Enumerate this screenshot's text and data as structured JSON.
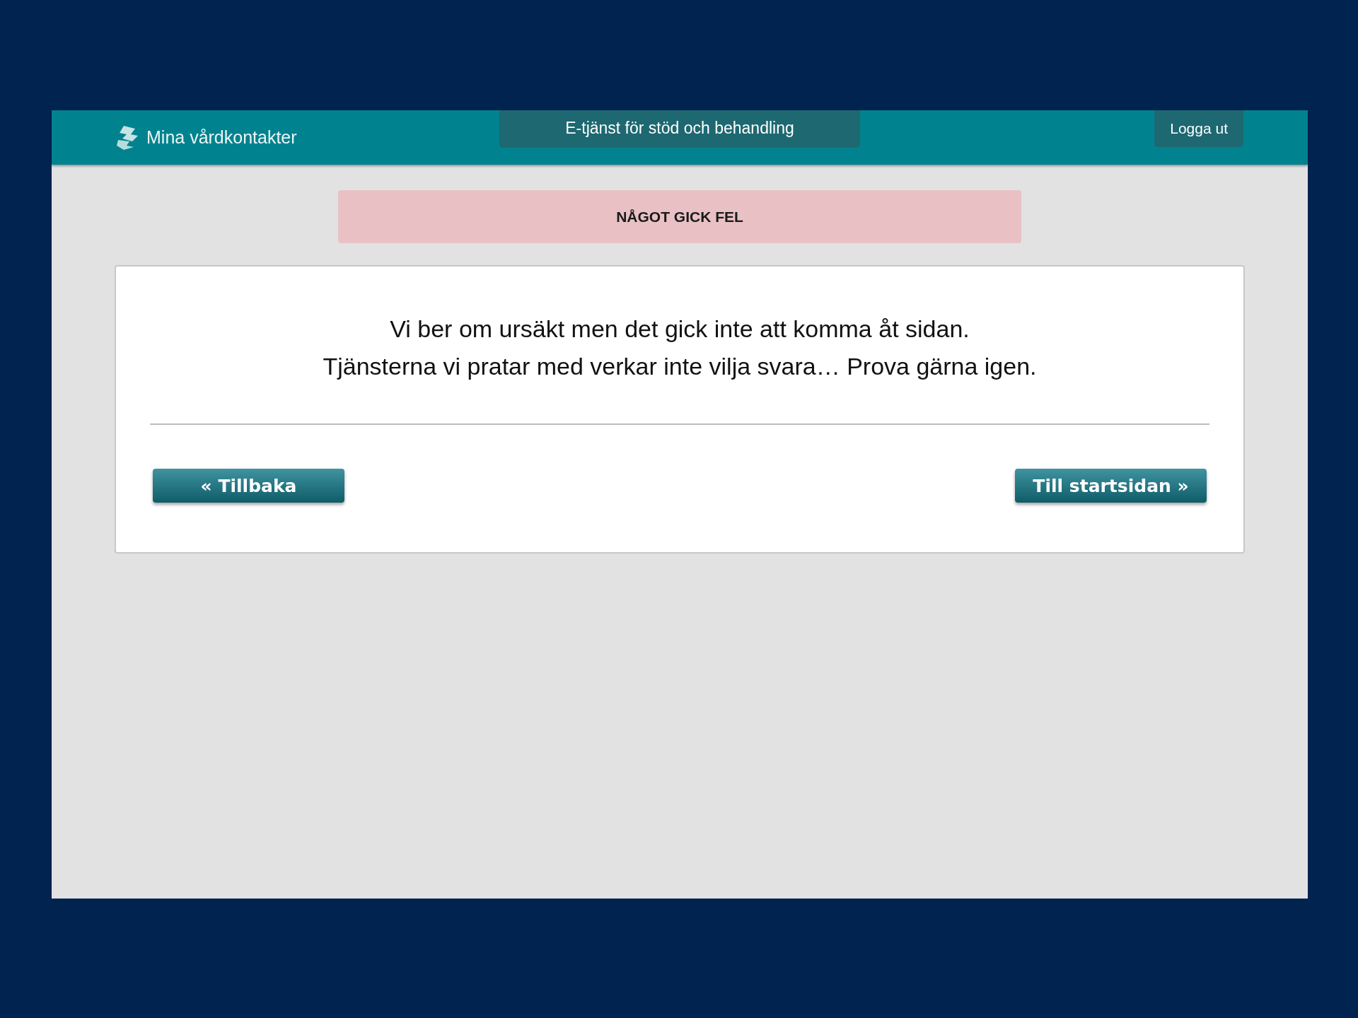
{
  "header": {
    "logo_text": "Mina vårdkontakter",
    "service_title": "E-tjänst för stöd och behandling",
    "logout": "Logga ut"
  },
  "alert": {
    "title": "NÅGOT GICK FEL"
  },
  "message": {
    "lines": [
      "Vi ber om ursäkt men det gick inte att komma åt sidan.",
      "Tjänsterna vi pratar med verkar inte vilja svara… Prova gärna igen."
    ]
  },
  "buttons": [
    {
      "label": "« Tillbaka"
    },
    {
      "label": "Till startsidan »"
    }
  ]
}
